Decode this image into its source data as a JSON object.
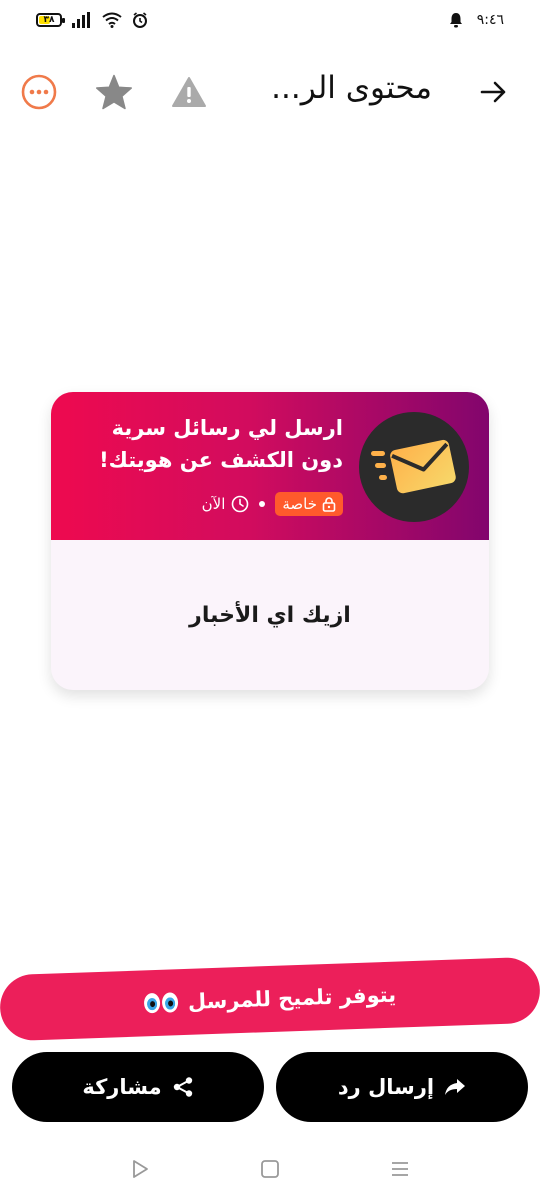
{
  "status_bar": {
    "battery_level": "٣٨",
    "time": "٩:٤٦"
  },
  "app_bar": {
    "title": "محتوى الر...",
    "icons": [
      "arrow-right-icon",
      "warning-icon",
      "star-icon",
      "more-options-icon"
    ]
  },
  "card": {
    "headline": "ارسل لي رسائل سرية دون الكشف عن هويتك!",
    "badge_label": "خاصة",
    "time_label": "الآن",
    "message": "ازيك اي الأخبار"
  },
  "hint_banner": {
    "label": "يتوفر تلميح للمرسل"
  },
  "actions": {
    "reply_label": "إرسال رد",
    "share_label": "مشاركة"
  },
  "colors": {
    "accent": "#ec1f5a",
    "header_gradient_start": "#ee0a4f",
    "header_gradient_end": "#82056d",
    "badge": "#ff5a2c",
    "more_icon": "#f07a4a",
    "button": "#000000"
  }
}
